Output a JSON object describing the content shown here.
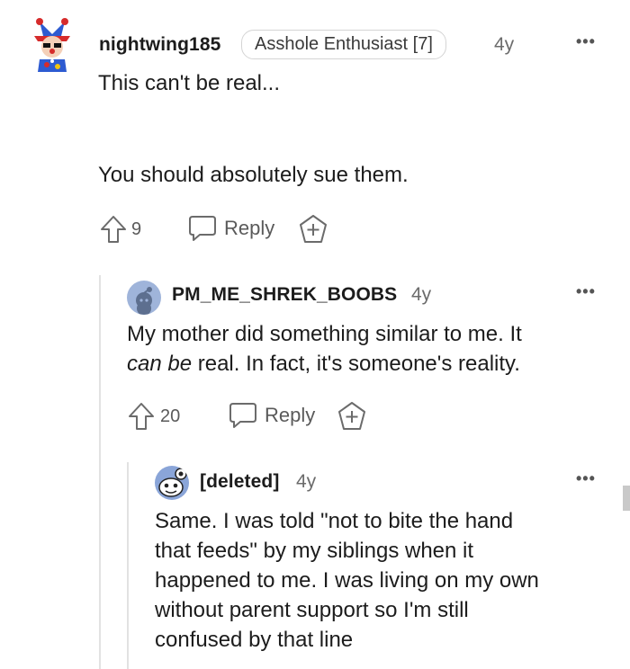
{
  "comments": [
    {
      "username": "nightwing185",
      "flair": "Asshole Enthusiast [7]",
      "age": "4y",
      "body": [
        "This can't be real...",
        "You should absolutely sue them."
      ],
      "upvotes": "9",
      "reply_label": "Reply"
    },
    {
      "username": "PM_ME_SHREK_BOOBS",
      "age": "4y",
      "body_line1": "My mother did something similar to me. It",
      "body_line2_italic": "can be",
      "body_line2_rest": " real. In fact, it's someone's reality.",
      "upvotes": "20",
      "reply_label": "Reply"
    },
    {
      "username": "[deleted]",
      "age": "4y",
      "body": [
        "Same. I was told \"not to bite the hand",
        "that feeds\" by my siblings when it",
        "happened to me. I was living on my own",
        "without parent support so I'm still",
        "confused by that line"
      ]
    }
  ],
  "more_menu_icon": "ellipsis-icon",
  "colors": {
    "avatar2_bg": "#9fb4da",
    "avatar3_bg": "#8aa5d8"
  }
}
